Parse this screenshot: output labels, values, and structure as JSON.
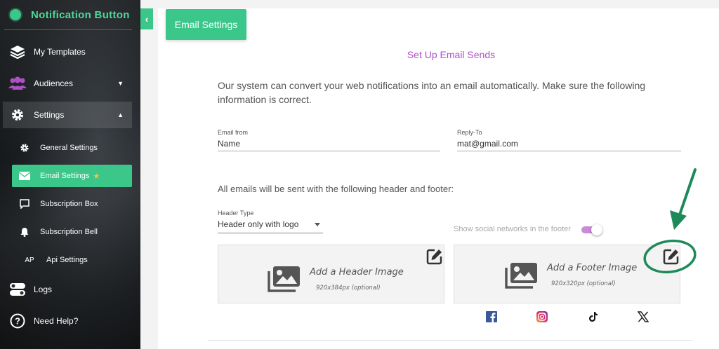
{
  "brand": {
    "title": "Notification Button",
    "accent": "#3cc78a"
  },
  "sidebar": {
    "items": [
      {
        "label": "My Templates",
        "icon": "layers-icon"
      },
      {
        "label": "Audiences",
        "icon": "users-icon"
      },
      {
        "label": "Settings",
        "icon": "gear-icon"
      },
      {
        "label": "Logs",
        "icon": "toggle-list-icon"
      },
      {
        "label": "Need Help?",
        "icon": "help-icon"
      }
    ],
    "sub_items": [
      {
        "label": "General Settings",
        "icon": "gear-icon"
      },
      {
        "label": "Email Settings",
        "icon": "envelope-icon"
      },
      {
        "label": "Subscription Box",
        "icon": "chat-box-icon"
      },
      {
        "label": "Subscription Bell",
        "icon": "bell-icon"
      },
      {
        "label": "Api Settings",
        "icon_text": "AP"
      }
    ]
  },
  "main": {
    "tab_label": "Email Settings",
    "setup_title": "Set Up Email Sends",
    "intro": "Our system can convert your web notifications into an email automatically. Make sure the following information is correct.",
    "email_from": {
      "label": "Email from",
      "value": "Name"
    },
    "reply_to": {
      "label": "Reply-To",
      "value": "mat@gmail.com"
    },
    "header_footer_text": "All emails will be sent with the following header and footer:",
    "header_type": {
      "label": "Header Type",
      "value": "Header only with logo"
    },
    "social_toggle_label": "Show social networks in the footer",
    "header_image": {
      "title": "Add a Header Image",
      "hint": "920x384px (optional)"
    },
    "footer_image": {
      "title": "Add a Footer Image",
      "hint": "920x320px (optional)"
    },
    "social_icons": [
      "facebook-icon",
      "instagram-icon",
      "tiktok-icon",
      "x-icon"
    ]
  }
}
